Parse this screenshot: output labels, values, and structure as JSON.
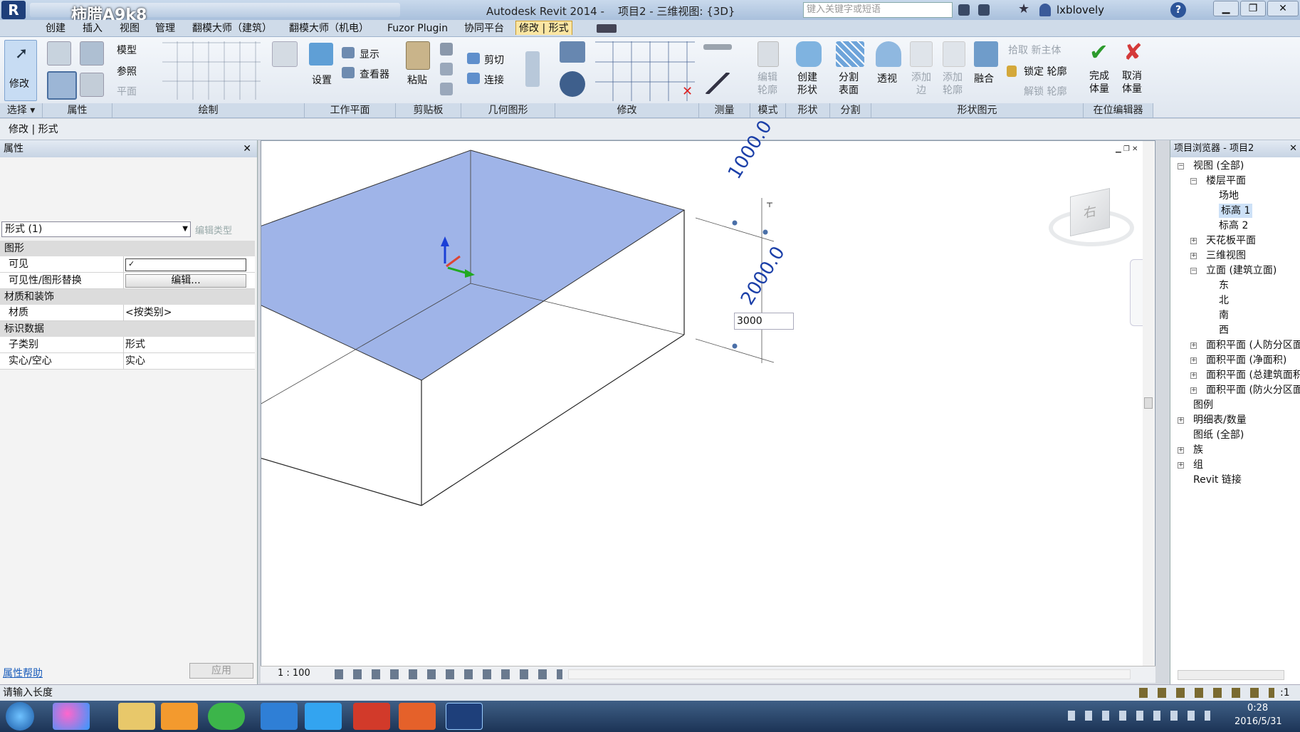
{
  "app": {
    "title": "Autodesk Revit 2014 -    项目2 - 三维视图: {3D}",
    "watermark": "柿腊A9k8",
    "search_placeholder": "键入关键字或短语",
    "user": "lxblovely"
  },
  "tabs": [
    "创建",
    "插入",
    "视图",
    "管理",
    "翻模大师（建筑）",
    "翻模大师（机电）",
    "Fuzor Plugin",
    "协同平台",
    "修改 | 形式"
  ],
  "ribbon": {
    "modify_label": "修改",
    "select_label": "选择 ▾",
    "draw": {
      "model": "模型",
      "ref": "参照",
      "plane": "平面"
    },
    "workplane": {
      "set": "设置",
      "show": "显示",
      "viewer": "查看器"
    },
    "clipboard": {
      "paste": "粘贴"
    },
    "geometry": {
      "cut": "剪切",
      "join": "连接"
    },
    "tools": {
      "edit_profile": "编辑\n轮廓",
      "create_form": "创建\n形状",
      "divide_surface": "分割\n表面",
      "xray": "透视",
      "add_edge": "添加\n边",
      "add_profile": "添加\n轮廓",
      "dissolve": "融合",
      "pick_host": "拾取 新主体",
      "lock_profile": "锁定 轮廓",
      "unlock_profile": "解锁 轮廓",
      "finish_mass": "完成\n体量",
      "cancel_mass": "取消\n体量"
    },
    "panels": [
      "选择",
      "属性",
      "绘制",
      "工作平面",
      "剪贴板",
      "几何图形",
      "修改",
      "测量",
      "模式",
      "形状",
      "分割",
      "形状图元",
      "在位编辑器"
    ]
  },
  "options_bar": "修改 | 形式",
  "properties": {
    "header": "属性",
    "type_selector": "形式 (1)",
    "edit_type": "编辑类型",
    "sections": [
      {
        "name": "图形",
        "rows": [
          {
            "k": "可见",
            "v": "✓"
          },
          {
            "k": "可见性/图形替换",
            "v": "编辑..."
          }
        ]
      },
      {
        "name": "材质和装饰",
        "rows": [
          {
            "k": "材质",
            "v": "<按类别>"
          }
        ]
      },
      {
        "name": "标识数据",
        "rows": [
          {
            "k": "子类别",
            "v": "形式"
          },
          {
            "k": "实心/空心",
            "v": "实心"
          }
        ]
      }
    ],
    "help": "属性帮助",
    "apply": "应用"
  },
  "viewport": {
    "dim_top": "1000.0",
    "dim_bottom": "2000.0",
    "input_value": "3000",
    "scale": "1 : 100",
    "viewcube_face": "右"
  },
  "browser": {
    "header": "项目浏览器 - 项目2",
    "items": [
      {
        "label": "视图 (全部)",
        "level": 0,
        "toggle": "-"
      },
      {
        "label": "楼层平面",
        "level": 1,
        "toggle": "-"
      },
      {
        "label": "场地",
        "level": 2,
        "toggle": ""
      },
      {
        "label": "标高 1",
        "level": 2,
        "toggle": "",
        "selected": true
      },
      {
        "label": "标高 2",
        "level": 2,
        "toggle": ""
      },
      {
        "label": "天花板平面",
        "level": 1,
        "toggle": "+"
      },
      {
        "label": "三维视图",
        "level": 1,
        "toggle": "+"
      },
      {
        "label": "立面 (建筑立面)",
        "level": 1,
        "toggle": "-"
      },
      {
        "label": "东",
        "level": 2,
        "toggle": ""
      },
      {
        "label": "北",
        "level": 2,
        "toggle": ""
      },
      {
        "label": "南",
        "level": 2,
        "toggle": ""
      },
      {
        "label": "西",
        "level": 2,
        "toggle": ""
      },
      {
        "label": "面积平面 (人防分区面",
        "level": 1,
        "toggle": "+"
      },
      {
        "label": "面积平面 (净面积)",
        "level": 1,
        "toggle": "+"
      },
      {
        "label": "面积平面 (总建筑面积",
        "level": 1,
        "toggle": "+"
      },
      {
        "label": "面积平面 (防火分区面",
        "level": 1,
        "toggle": "+"
      },
      {
        "label": "图例",
        "level": 0,
        "toggle": ""
      },
      {
        "label": "明细表/数量",
        "level": 0,
        "toggle": "+"
      },
      {
        "label": "图纸 (全部)",
        "level": 0,
        "toggle": ""
      },
      {
        "label": "族",
        "level": 0,
        "toggle": "+"
      },
      {
        "label": "组",
        "level": 0,
        "toggle": "+"
      },
      {
        "label": "Revit 链接",
        "level": 0,
        "toggle": ""
      }
    ]
  },
  "status": {
    "prompt": "请输入长度",
    "filter": ":1"
  },
  "taskbar": {
    "time": "0:28",
    "date": "2016/5/31"
  },
  "colors": {
    "face": "#9fb4e8",
    "accent": "#fbe6a3",
    "dim": "#1b3fa8"
  }
}
